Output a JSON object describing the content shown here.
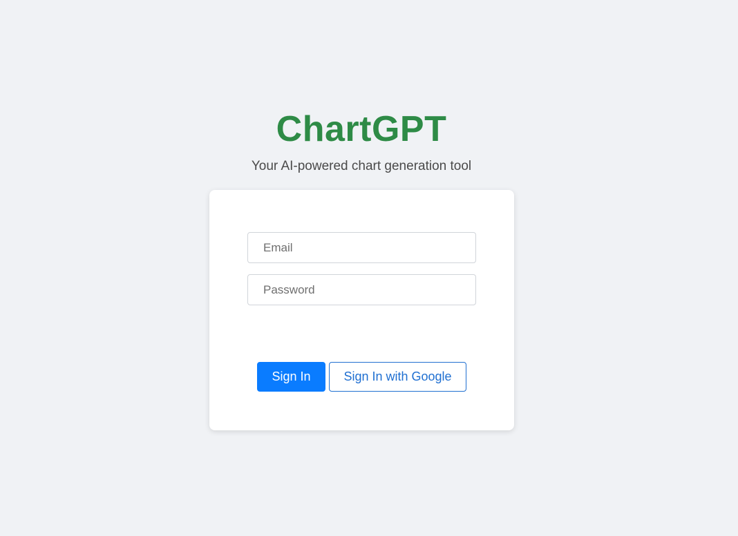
{
  "header": {
    "title": "ChartGPT",
    "subtitle": "Your AI-powered chart generation tool"
  },
  "login_form": {
    "email": {
      "placeholder": "Email",
      "value": ""
    },
    "password": {
      "placeholder": "Password",
      "value": ""
    },
    "sign_in_label": "Sign In",
    "google_sign_in_label": "Sign In with Google"
  },
  "colors": {
    "background": "#f0f2f5",
    "brand_green": "#2e8b46",
    "primary_blue": "#0a7cff",
    "outline_blue": "#1f6fd1",
    "card": "#ffffff"
  }
}
